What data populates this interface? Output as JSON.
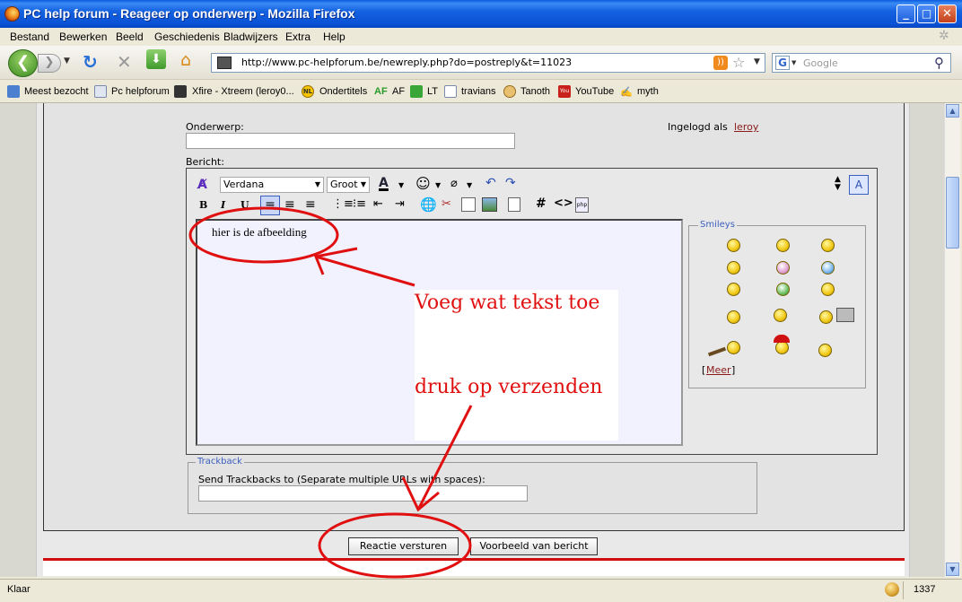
{
  "window": {
    "title": "PC help forum - Reageer op onderwerp - Mozilla Firefox",
    "minimize": "_",
    "maximize": "□",
    "close": "✕"
  },
  "menu": [
    "Bestand",
    "Bewerken",
    "Beeld",
    "Geschiedenis",
    "Bladwijzers",
    "Extra",
    "Help"
  ],
  "nav": {
    "back_glyph": "❮",
    "forward_glyph": "❯",
    "url": "http://www.pc-helpforum.be/newreply.php?do=postreply&t=11023",
    "search_placeholder": "Google"
  },
  "bookmarks": [
    "Meest bezocht",
    "Pc helpforum",
    "Xfire - Xtreem (leroy0...",
    "Ondertitels",
    "AF",
    "LT",
    "travians",
    "Tanoth",
    "YouTube",
    "myth"
  ],
  "form": {
    "subject_label": "Onderwerp:",
    "logged_in_prefix": "Ingelogd als",
    "logged_in_user": "leroy",
    "message_label": "Bericht:",
    "font": "Verdana",
    "size": "Groot",
    "message_text": "hier is de afbeelding",
    "smileys_legend": "Smileys",
    "more_link": "Meer",
    "trackback_legend": "Trackback",
    "trackback_label": "Send Trackbacks to (Separate multiple URLs with spaces):",
    "submit_button": "Reactie versturen",
    "preview_button": "Voorbeeld van bericht"
  },
  "annotations": {
    "line1": "Voeg wat tekst toe",
    "line2": "druk op verzenden"
  },
  "status": {
    "text": "Klaar",
    "count": "1337"
  },
  "colors": {
    "annotation_red": "#e01010",
    "titlebar_blue": "#0A52D6"
  }
}
